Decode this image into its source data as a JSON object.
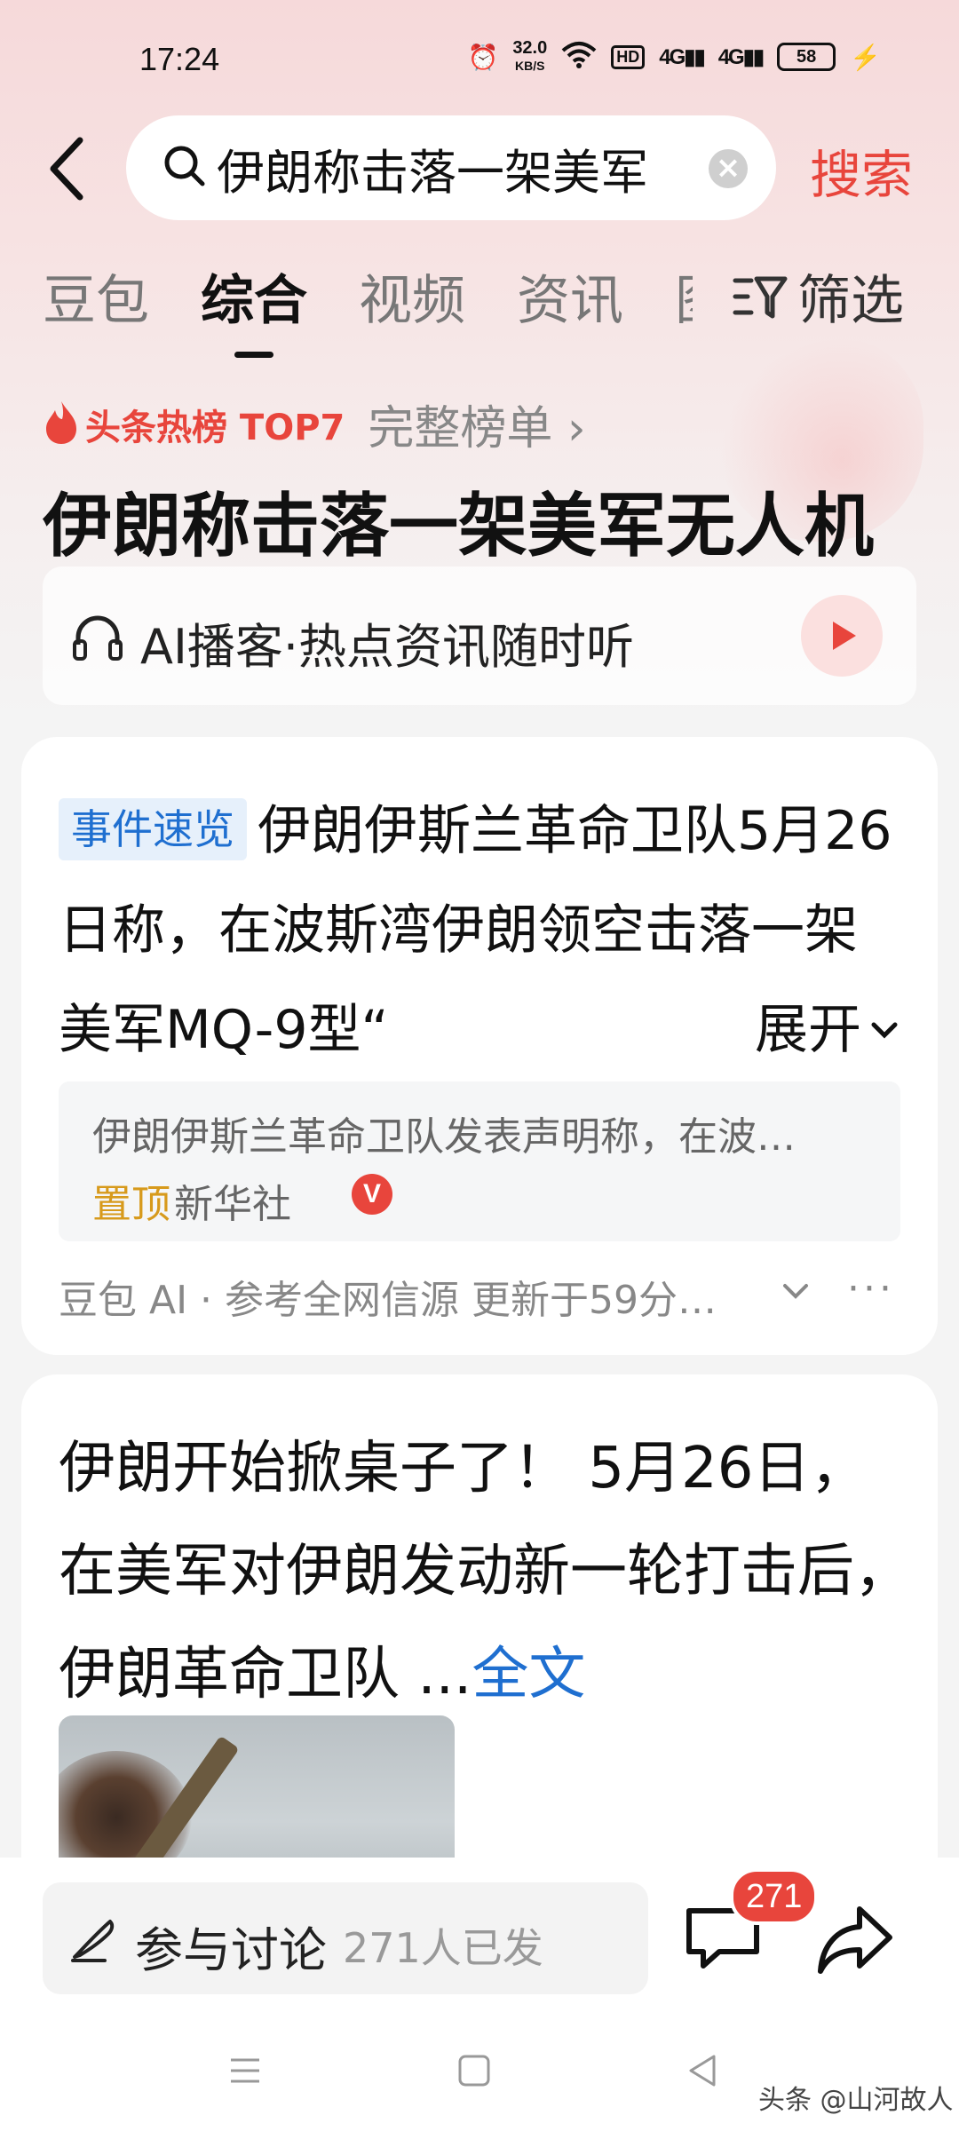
{
  "status_bar": {
    "time": "17:24",
    "net_speed": "32.0",
    "net_unit": "KB/S",
    "hd": "HD",
    "sig1": "4G",
    "sig2": "4G",
    "battery": "58"
  },
  "search": {
    "query": "伊朗称击落一架美军",
    "button": "搜索"
  },
  "tabs": [
    {
      "label": "豆包"
    },
    {
      "label": "综合"
    },
    {
      "label": "视频"
    },
    {
      "label": "资讯"
    },
    {
      "label": "图"
    }
  ],
  "active_tab": "综合",
  "filter_label": "筛选",
  "hot": {
    "label": "头条热榜 TOP7",
    "link": "完整榜单 ›",
    "title": "伊朗称击落一架美军无人机"
  },
  "podcast": {
    "label": "AI播客·热点资讯随时听"
  },
  "event_card": {
    "tag": "事件速览",
    "summary": "伊朗伊斯兰革命卫队5月26日称，在波斯湾伊朗领空击落一架美军MQ-9型“",
    "expand": "展开",
    "source_desc": "伊朗伊斯兰革命卫队发表声明称，在波…",
    "pinned": "置顶",
    "publisher": "新华社",
    "verified": "V",
    "footer": "豆包 AI · 参考全网信源 更新于59分…",
    "more": "···"
  },
  "article": {
    "text": "伊朗开始掀桌子了！ 5月26日，在美军对伊朗发动新一轮打击后，伊朗革命卫队 ...",
    "fulltext": "全文"
  },
  "bottom": {
    "discuss": "参与讨论",
    "discuss_count": "271人已发",
    "comment_badge": "271"
  },
  "watermark": "头条 @山河故人",
  "colors": {
    "accent": "#e8453c",
    "link": "#1f6fd0",
    "pinned": "#d79a1c"
  }
}
